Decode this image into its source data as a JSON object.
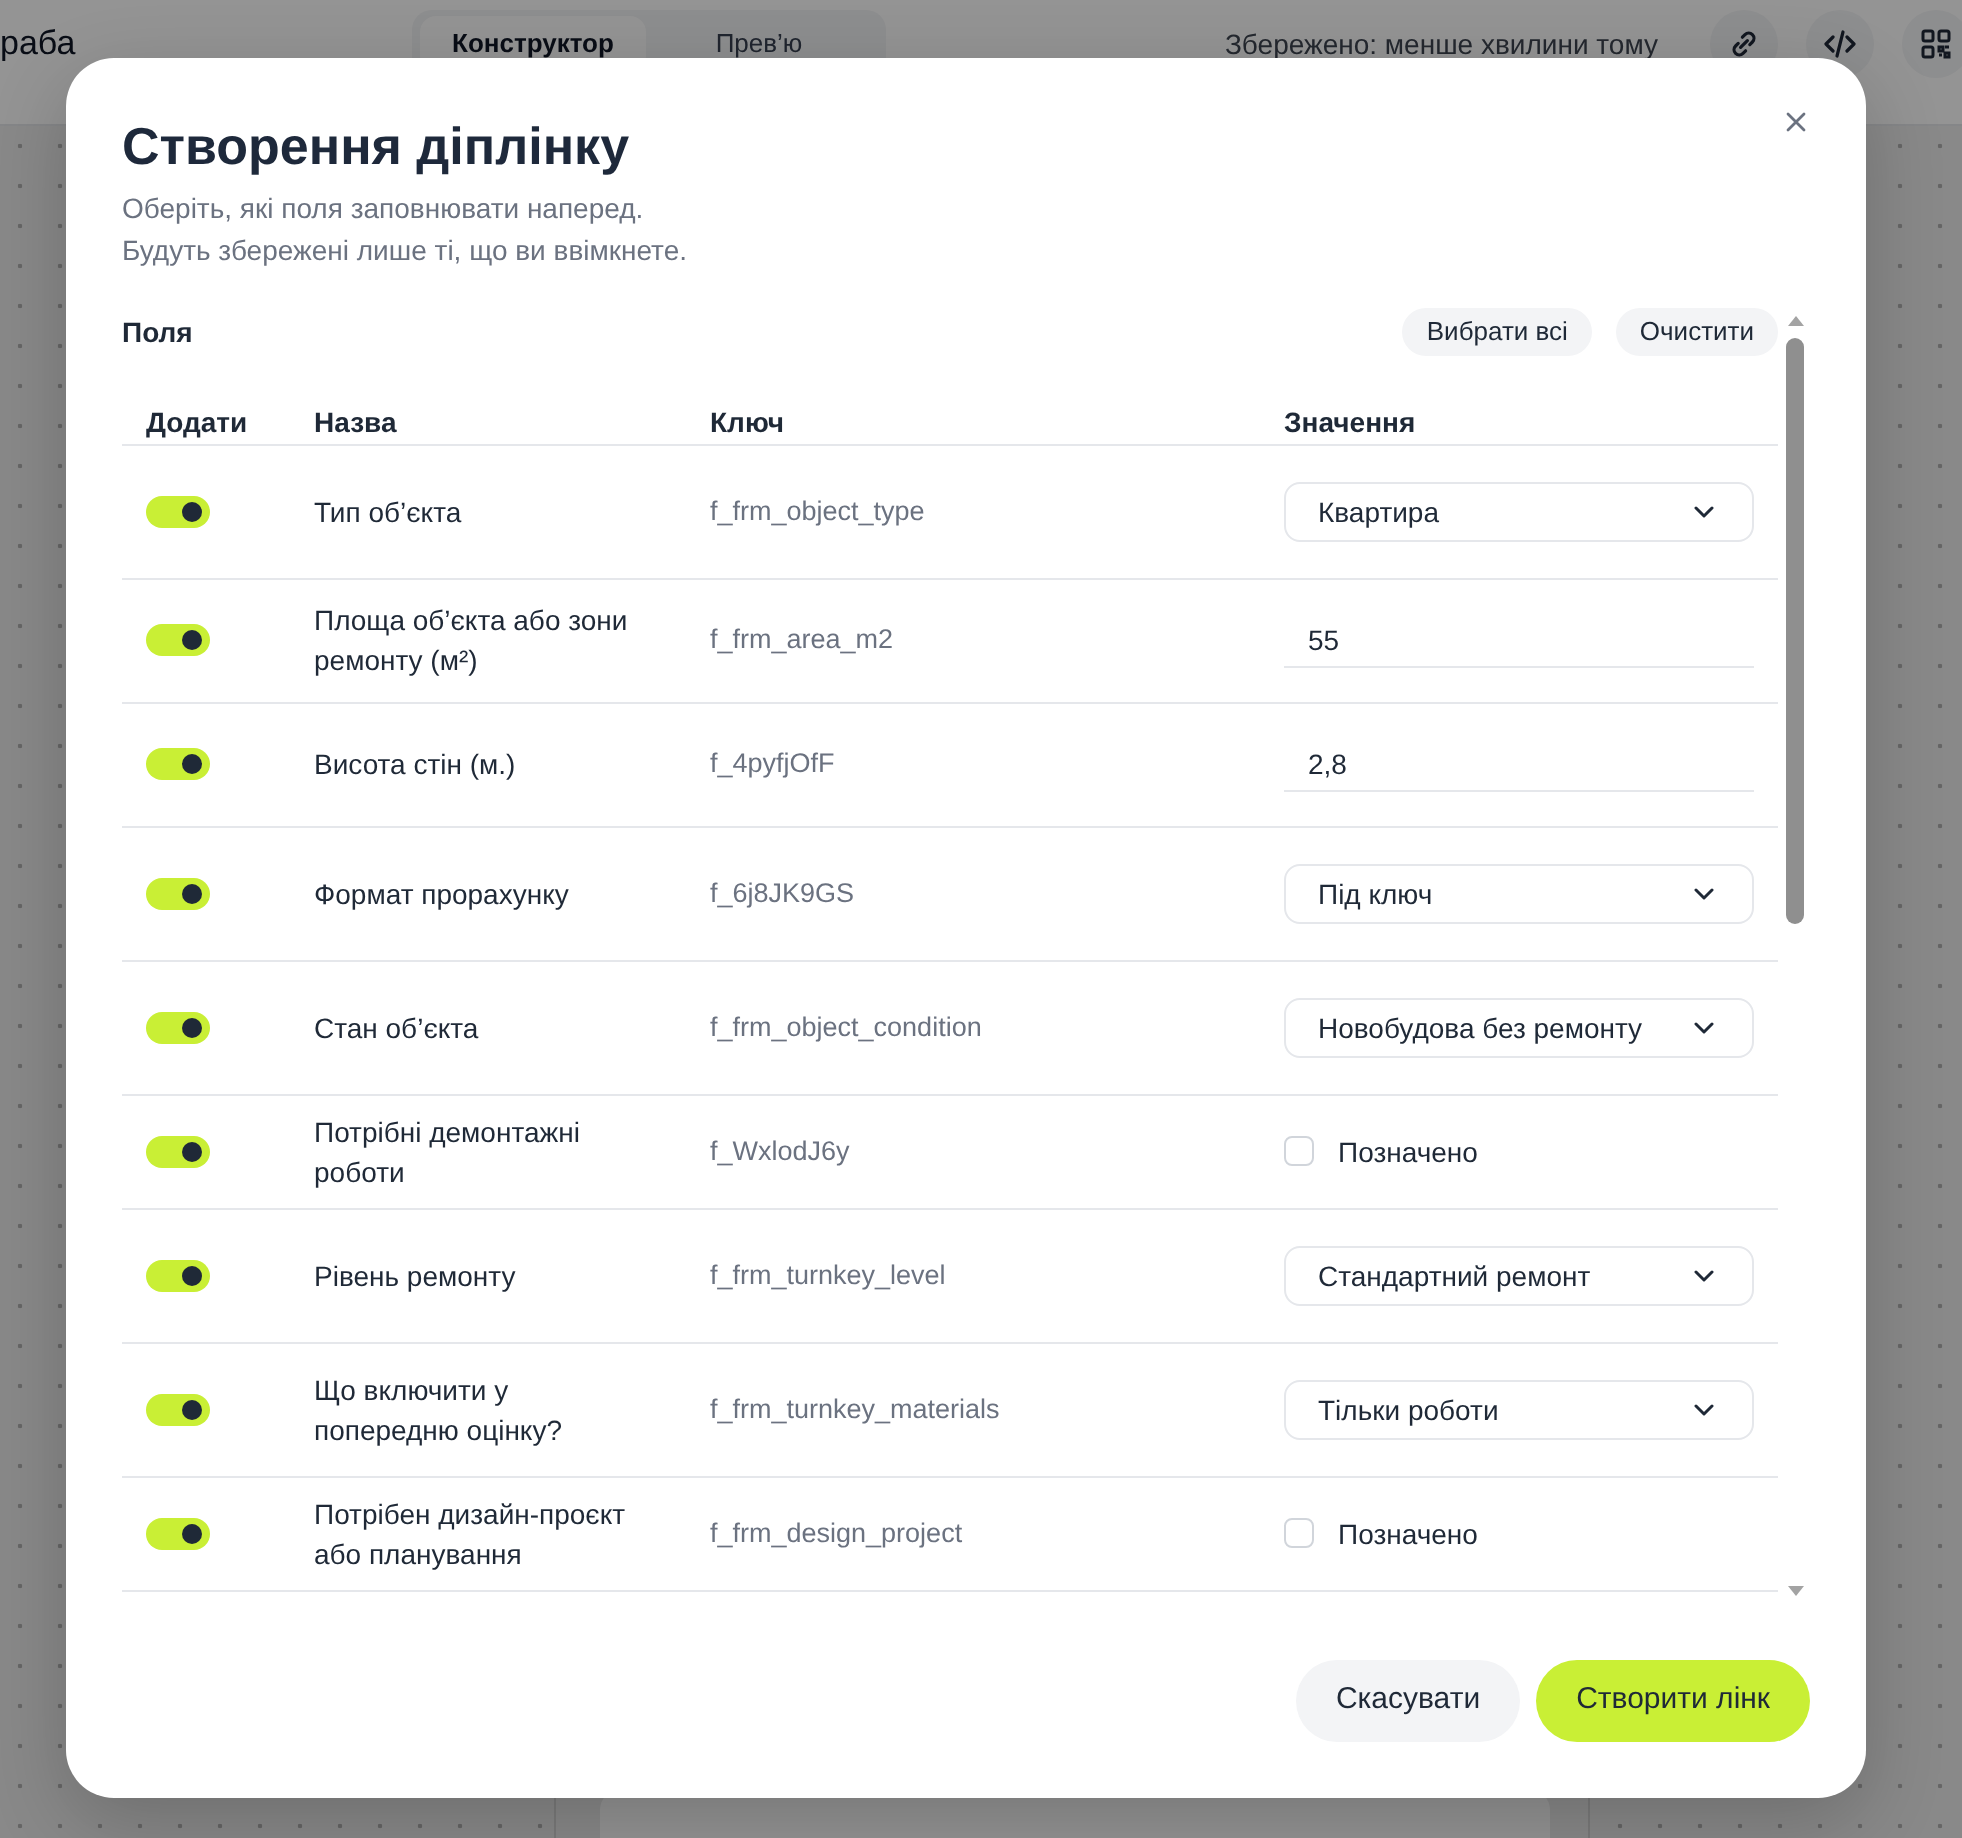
{
  "app_bar": {
    "title": "раба",
    "tabs": [
      {
        "label": "Конструктор",
        "selected": true
      },
      {
        "label": "Прев’ю",
        "selected": false
      }
    ],
    "save_status": "Збережено: менше хвилини тому"
  },
  "dialog": {
    "title": "Створення діплінку",
    "description": [
      "Оберіть, які поля заповнювати наперед.",
      "Будуть збережені лише ті, що ви ввімкнете."
    ],
    "fields_section": {
      "label": "Поля",
      "actions": [
        "Вибрати всі",
        "Очистити"
      ]
    },
    "columns": [
      "Додати",
      "Назва",
      "Ключ",
      "Значення"
    ],
    "rows": [
      {
        "enabled": true,
        "name": "Тип об’єкта",
        "key": "f_frm_object_type",
        "kind": "select",
        "value": "Квартира"
      },
      {
        "enabled": true,
        "name": "Площа об’єкта або зони ремонту (м²)",
        "key": "f_frm_area_m2",
        "kind": "input",
        "value": "55"
      },
      {
        "enabled": true,
        "name": "Висота стін (м.)",
        "key": "f_4pyfjOfF",
        "kind": "input",
        "value": "2,8"
      },
      {
        "enabled": true,
        "name": "Формат прорахунку",
        "key": "f_6j8JK9GS",
        "kind": "select",
        "value": "Під ключ"
      },
      {
        "enabled": true,
        "name": "Стан об’єкта",
        "key": "f_frm_object_condition",
        "kind": "select",
        "value": "Новобудова без ремонту"
      },
      {
        "enabled": true,
        "name": "Потрібні демонтажні роботи",
        "key": "f_WxlodJ6y",
        "kind": "checkbox",
        "checked": false,
        "value": "Позначено"
      },
      {
        "enabled": true,
        "name": "Рівень ремонту",
        "key": "f_frm_turnkey_level",
        "kind": "select",
        "value": "Стандартний ремонт"
      },
      {
        "enabled": true,
        "name": "Що включити у попередню оцінку?",
        "key": "f_frm_turnkey_materials",
        "kind": "select",
        "value": "Тільки роботи"
      },
      {
        "enabled": true,
        "name": "Потрібен дизайн-проєкт або планування",
        "key": "f_frm_design_project",
        "kind": "checkbox",
        "checked": false,
        "value": "Позначено"
      }
    ],
    "buttons": [
      {
        "label": "Скасувати",
        "kind": "secondary"
      },
      {
        "label": "Створити лінк",
        "kind": "primary"
      }
    ]
  }
}
